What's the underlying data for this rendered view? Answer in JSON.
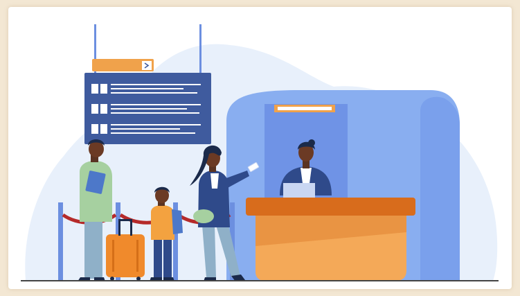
{
  "scene": {
    "palette": {
      "background_outer": "#f3e7d3",
      "background_inner": "#ffffff",
      "cloud": "#e8f0fb",
      "board_blue": "#3f5b9e",
      "sign_orange": "#f0a24b",
      "booth_blue": "#89aef0",
      "booth_blue_dark": "#6f93e6",
      "counter_orange": "#f4a958",
      "counter_top": "#d86c1c",
      "post_blue": "#6c8fe0",
      "rope_red": "#b52a2a",
      "suitcase_orange": "#f08a2c",
      "ground_line": "#444444"
    },
    "icons": {
      "sign_arrow": "chevron-right-icon",
      "ticket": "ticket-icon"
    }
  }
}
